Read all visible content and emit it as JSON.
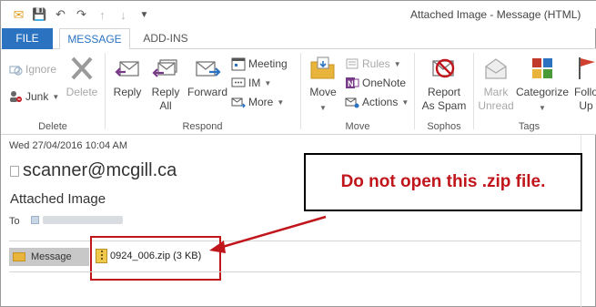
{
  "window": {
    "title": "Attached Image - Message (HTML)"
  },
  "quick_access": {
    "icons": [
      "mail-icon",
      "save-icon",
      "undo-icon",
      "redo-icon",
      "up-arrow-icon",
      "down-arrow-icon",
      "more-icon"
    ]
  },
  "tabs": [
    {
      "label": "FILE"
    },
    {
      "label": "MESSAGE"
    },
    {
      "label": "ADD-INS"
    }
  ],
  "ribbon": {
    "delete": {
      "group_label": "Delete",
      "ignore": "Ignore",
      "junk": "Junk",
      "delete": "Delete"
    },
    "respond": {
      "group_label": "Respond",
      "reply": "Reply",
      "reply_all_line1": "Reply",
      "reply_all_line2": "All",
      "forward": "Forward",
      "meeting": "Meeting",
      "im": "IM",
      "more": "More"
    },
    "move": {
      "group_label": "Move",
      "move": "Move",
      "rules": "Rules",
      "onenote": "OneNote",
      "actions": "Actions"
    },
    "sophos": {
      "group_label": "Sophos",
      "report_line1": "Report",
      "report_line2": "As Spam"
    },
    "tags": {
      "group_label": "Tags",
      "mark_line1": "Mark",
      "mark_line2": "Unread",
      "categorize": "Categorize",
      "follow_line1": "Follo",
      "follow_line2": "Up"
    }
  },
  "message": {
    "date": "Wed 27/04/2016 10:04 AM",
    "sender": "scanner@mcgill.ca",
    "subject": "Attached Image",
    "to_label": "To",
    "message_tab": "Message",
    "attachment": "0924_006.zip (3 KB)"
  },
  "annotation": {
    "text": "Do not open this .zip file.",
    "color": "#c0151b"
  },
  "colors": {
    "file_tab": "#2b73c0",
    "accent": "#2b73c0",
    "warning": "#c0151b"
  }
}
